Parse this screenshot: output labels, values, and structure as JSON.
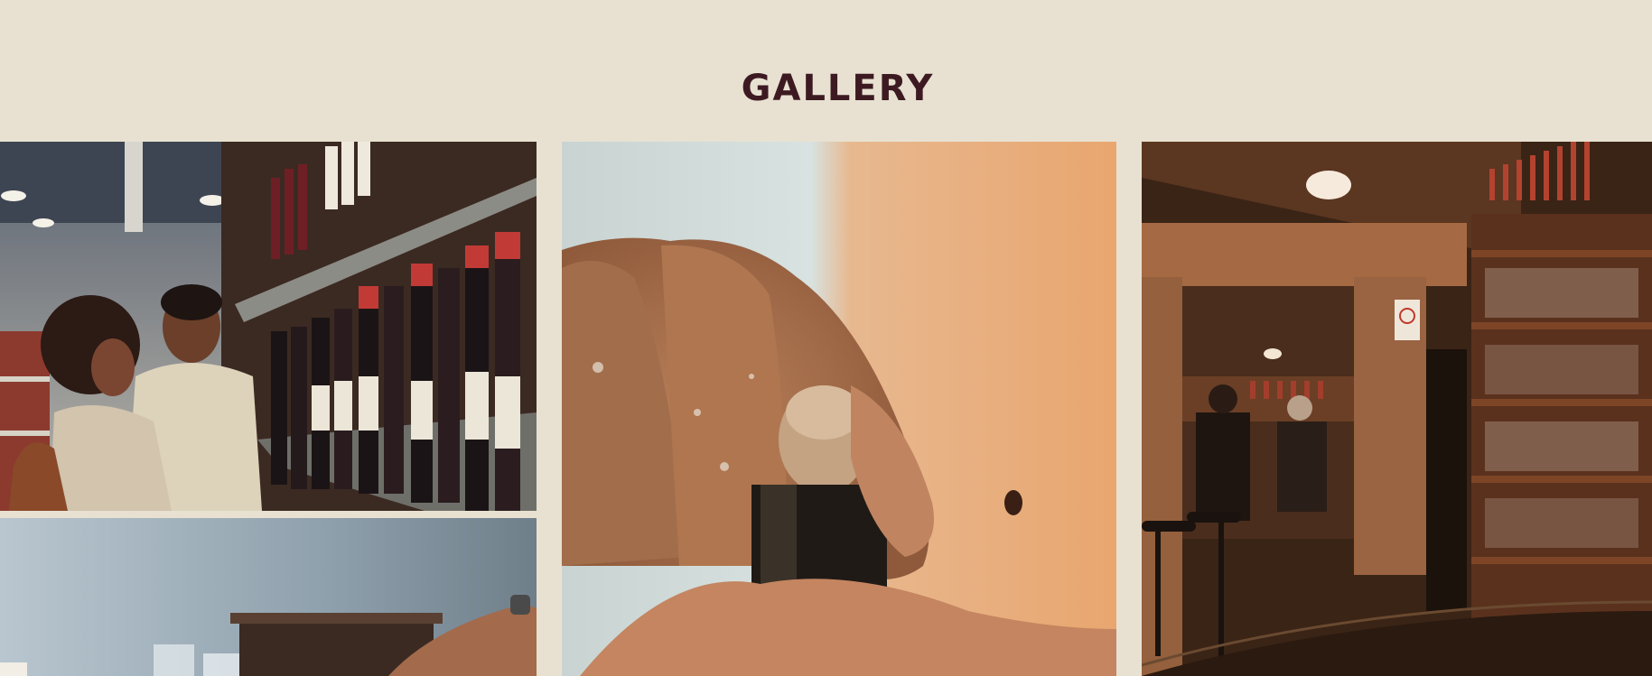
{
  "gallery": {
    "title": "GALLERY"
  },
  "colors": {
    "background": "#e8e1d1",
    "title": "#3d1a22"
  },
  "images": [
    {
      "name": "couple-choosing-wine-photo"
    },
    {
      "name": "wine-glasses-bar-photo"
    },
    {
      "name": "hand-opening-bottle-cork-photo"
    },
    {
      "name": "wine-bar-cellar-interior-photo"
    }
  ]
}
